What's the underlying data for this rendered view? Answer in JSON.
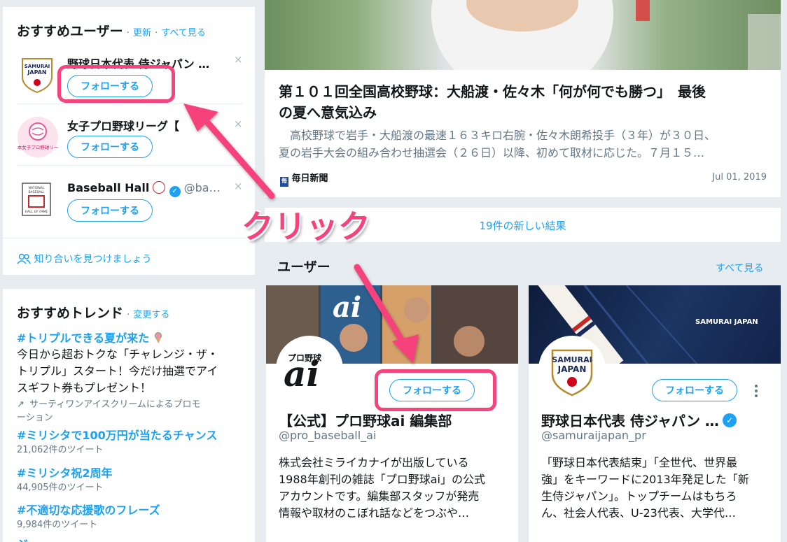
{
  "who_to_follow": {
    "title": "おすすめユーザー",
    "refresh_label": "更新",
    "view_all_label": "すべて見る",
    "sep": "·",
    "follow_label": "フォローする",
    "close_glyph": "×",
    "users": [
      {
        "name": "野球日本代表 侍ジャパン …",
        "handle": "",
        "avatar_text": "SAMURAI JAPAN"
      },
      {
        "name": "女子プロ野球リーグ【",
        "handle": "",
        "avatar_text": "日本女子プロ野球リーグ"
      },
      {
        "name": "Baseball Hall",
        "handle": "@ba…",
        "avatar_text": "BASEBALL HALL OF FAME"
      }
    ],
    "find_people_label": "知り合いを見つけましょう"
  },
  "trends": {
    "title": "おすすめトレンド",
    "change_label": "変更する",
    "sep": "·",
    "promoted": {
      "tag": "#トリプルできる夏が来た",
      "desc_lines": [
        "今日から超おトクな「チャレンジ・ザ・",
        "トリプル」スタート！今だけ抽選でアイ",
        "スギフト券もプレゼント！"
      ],
      "promo_lines": [
        "サーティワンアイスクリームによるプロモ",
        "ーション"
      ]
    },
    "items": [
      {
        "tag": "#ミリシタで100万円が当たるチャンス",
        "count": "21,062件のツイート"
      },
      {
        "tag": "#ミリシタ祝2周年",
        "count": "44,905件のツイート"
      },
      {
        "tag": "#不適切な応援歌のフレーズ",
        "count": "9,984件のツイート"
      }
    ],
    "cut_off_text": "ジ…ー ー"
  },
  "news": {
    "headline_line1": "第１０１回全国高校野球：大船渡・佐々木「何が何でも勝つ」　最後",
    "headline_line2": "の夏へ意気込み",
    "summary_line1": "　高校野球で岩手・大船渡の最速１６３キロ右腕・佐々木朗希投手（３年）が３０日、",
    "summary_line2": "夏の岩手大会の組み合わせ抽選会（２６日）以降、初めて取材に応じた。７月１５…",
    "source": "毎日新聞",
    "date": "Jul 01, 2019"
  },
  "new_results_label": "19件の新しい結果",
  "users_section": {
    "title": "ユーザー",
    "view_all_label": "すべて見る",
    "cards": [
      {
        "name": "【公式】プロ野球ai 編集部",
        "handle": "@pro_baseball_ai",
        "bio_lines": [
          "株式会社ミライカナイが出版している",
          "1988年創刊の雑誌「プロ野球ai」の公式",
          "アカウントです。編集部スタッフが発売",
          "情報や取材のこぼれ話などをつぶや…"
        ],
        "follow_label": "フォローする",
        "avatar_small": "プロ野球",
        "avatar_big": "ai"
      },
      {
        "name": "野球日本代表 侍ジャパン …",
        "handle": "@samuraijapan_pr",
        "bio_lines": [
          "「野球日本代表結束」「全世代、世界最",
          "強」をキーワードに2013年発足した「新",
          "生侍ジャパン」。トップチームはもちろ",
          "ん、社会人代表、U-23代表、大学代…"
        ],
        "follow_label": "フォローする",
        "avatar_text": "SAMURAI JAPAN",
        "banner_text": "SAMURAI JAPAN"
      }
    ]
  },
  "annotation": {
    "click_label": "クリック",
    "color": "#f6437c"
  },
  "colors": {
    "accent": "#1da1f2",
    "background": "#e6ecf0",
    "annotation": "#f6437c"
  }
}
